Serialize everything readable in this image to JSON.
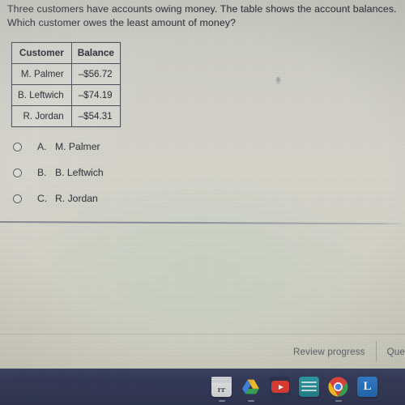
{
  "question": {
    "line1": "Three customers have accounts owing money. The table shows the account balances.",
    "line2": "Which customer owes the least amount of money?"
  },
  "table": {
    "headers": [
      "Customer",
      "Balance"
    ],
    "rows": [
      {
        "customer": "M. Palmer",
        "balance": "–$56.72"
      },
      {
        "customer": "B. Leftwich",
        "balance": "–$74.19"
      },
      {
        "customer": "R. Jordan",
        "balance": "–$54.31"
      }
    ]
  },
  "choices": [
    {
      "letter": "A.",
      "label": "M. Palmer",
      "selected": false
    },
    {
      "letter": "B.",
      "label": "B. Leftwich",
      "selected": false
    },
    {
      "letter": "C.",
      "label": "R. Jordan",
      "selected": false
    }
  ],
  "action_bar": {
    "review_progress": "Review progress",
    "next_partial": "Que"
  },
  "dock": {
    "items": [
      {
        "name": "document-app",
        "glyph": "rr"
      },
      {
        "name": "google-drive-app",
        "glyph": ""
      },
      {
        "name": "youtube-app",
        "glyph": ""
      },
      {
        "name": "teal-notes-app",
        "glyph": ""
      },
      {
        "name": "google-chrome-app",
        "glyph": ""
      },
      {
        "name": "blue-l-app",
        "glyph": "L"
      }
    ]
  },
  "colors": {
    "screen_bg": "#d4d4cb",
    "text": "#33363f",
    "table_border": "#4a4d55",
    "muted_button": "#6a6a74",
    "dock_bg": "#343a5b",
    "youtube_red": "#e03b32",
    "drive_blue": "#3f7de0",
    "drive_green": "#3ba55c",
    "drive_yellow": "#f2c03a",
    "chrome_red": "#e8453c",
    "chrome_yellow": "#f7c51c",
    "chrome_green": "#34a853",
    "chrome_blue": "#4285f4",
    "lapp_blue": "#2f7fd1",
    "teal": "#2b9fa8"
  }
}
